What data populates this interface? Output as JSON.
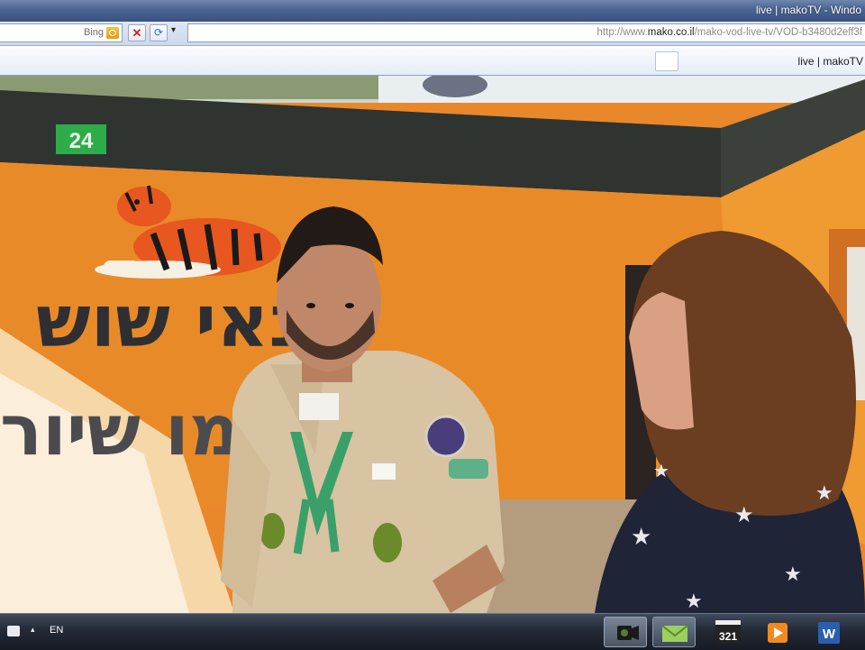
{
  "window": {
    "title": "live | makoTV - Windo"
  },
  "toolbar": {
    "search_provider": "Bing",
    "stop_icon": "✕",
    "refresh_icon": "⟳",
    "dropdown_icon": "▾",
    "url_prefix": "http://www.",
    "url_domain": "mako.co.il",
    "url_path": "/mako-vod-live-tv/VOD-b3480d2eff3f"
  },
  "tabs": {
    "active_tab_label": "live | makoTV"
  },
  "video": {
    "channel_logo_text": "24",
    "wall_text_line1": "נאי שוש",
    "wall_text_line2": "חמו שיור",
    "colors": {
      "wall": "#e98a28",
      "shirt": "#d8c3a2",
      "scarf": "#3aa06a"
    }
  },
  "taskbar": {
    "language": "EN",
    "tray_arrow": "▴",
    "media321_label": "321",
    "word_label": "W"
  }
}
